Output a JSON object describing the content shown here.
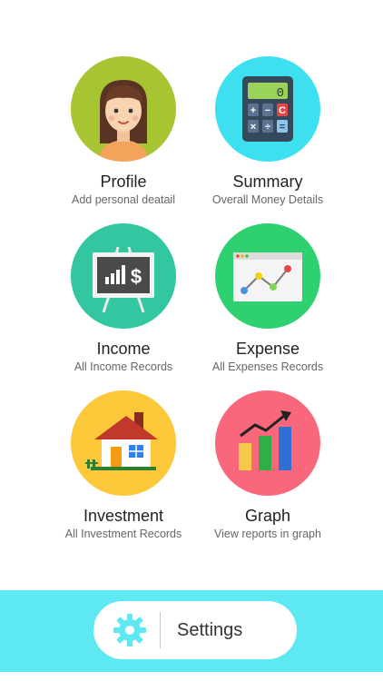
{
  "tiles": {
    "profile": {
      "title": "Profile",
      "subtitle": "Add personal deatail",
      "icon": "person-avatar-icon",
      "color": "#a7c433"
    },
    "summary": {
      "title": "Summary",
      "subtitle": "Overall Money Details",
      "icon": "calculator-icon",
      "color": "#3ee0ef"
    },
    "income": {
      "title": "Income",
      "subtitle": "All Income Records",
      "icon": "presentation-board-icon",
      "color": "#32c7a0"
    },
    "expense": {
      "title": "Expense",
      "subtitle": "All Expenses Records",
      "icon": "line-chart-window-icon",
      "color": "#2fd06f"
    },
    "investment": {
      "title": "Investment",
      "subtitle": "All Investment Records",
      "icon": "house-icon",
      "color": "#fbc83a"
    },
    "graph": {
      "title": "Graph",
      "subtitle": "View reports in graph",
      "icon": "bar-graph-arrow-icon",
      "color": "#f9687a"
    }
  },
  "calculator": {
    "display": "0",
    "keys": [
      "+",
      "−",
      "C",
      "×",
      "÷",
      "="
    ]
  },
  "board": {
    "symbol": "$"
  },
  "bottom_bar": {
    "settings_label": "Settings",
    "icon": "gear-icon",
    "color": "#5ee8f2"
  }
}
